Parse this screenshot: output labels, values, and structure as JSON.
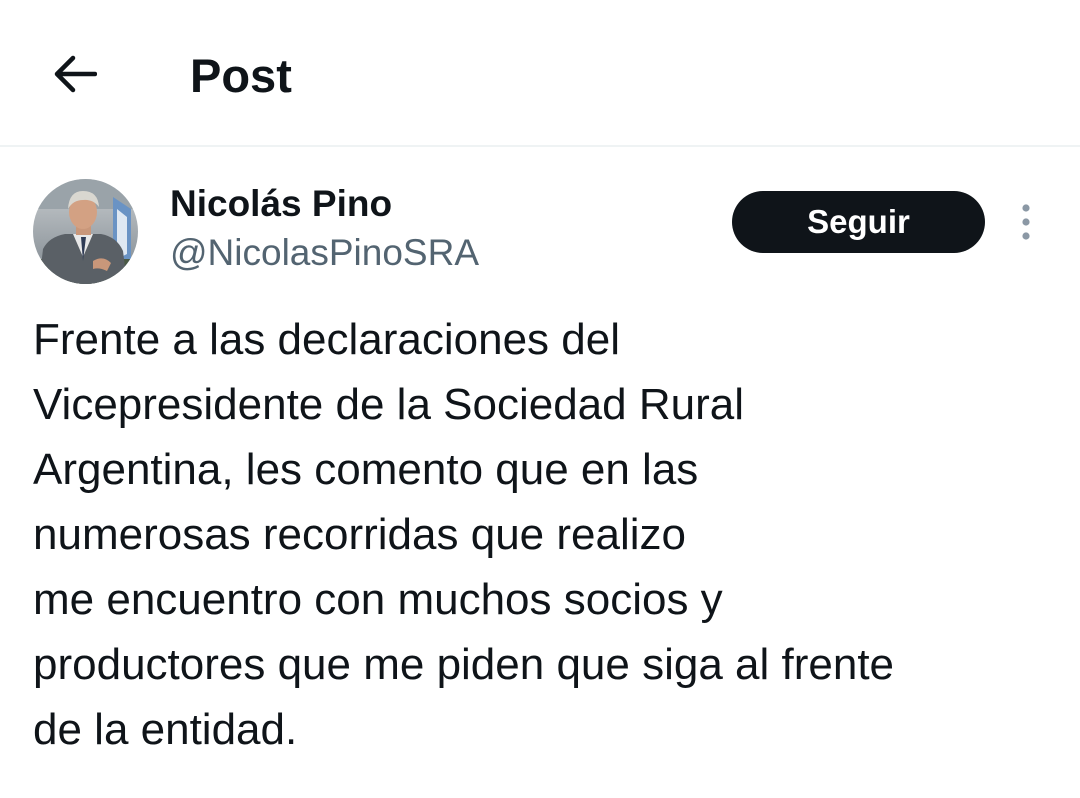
{
  "header": {
    "back_icon": "arrow-left-icon",
    "title": "Post"
  },
  "post": {
    "author": {
      "name": "Nicolás Pino",
      "handle": "@NicolasPinoSRA",
      "avatar_icon": "profile-photo"
    },
    "follow_label": "Seguir",
    "more_icon": "more-vertical-icon",
    "text_lines": [
      "Frente a las declaraciones del",
      "Vicepresidente de la Sociedad Rural",
      "Argentina, les comento que en las",
      "numerosas recorridas que realizo",
      "me encuentro con muchos socios y",
      "productores que me piden que siga al frente",
      "de la entidad."
    ]
  },
  "colors": {
    "text_primary": "#0f1419",
    "text_secondary": "#536471",
    "follow_button_bg": "#0f1419",
    "divider": "#eff3f4"
  }
}
